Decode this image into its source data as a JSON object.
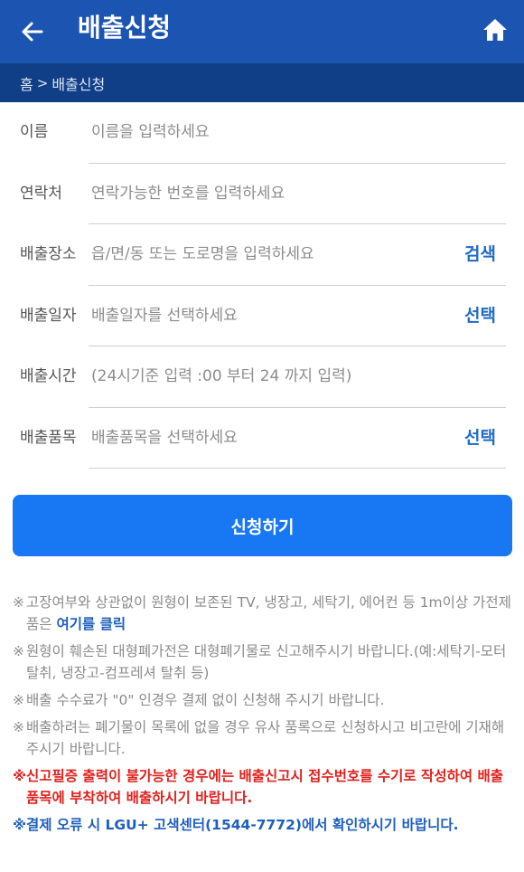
{
  "header": {
    "title": "배출신청"
  },
  "breadcrumb": {
    "home": "홈",
    "sep": ">",
    "current": "배출신청"
  },
  "form": {
    "rows": [
      {
        "label": "이름",
        "placeholder": "이름을 입력하세요",
        "action": ""
      },
      {
        "label": "연락처",
        "placeholder": "연락가능한 번호를 입력하세요",
        "action": ""
      },
      {
        "label": "배출장소",
        "placeholder": "읍/면/동 또는 도로명을 입력하세요",
        "action": "검색"
      },
      {
        "label": "배출일자",
        "placeholder": "배출일자를 선택하세요",
        "action": "선택"
      },
      {
        "label": "배출시간",
        "placeholder": "(24시기준 입력 :00 부터 24 까지 입력)",
        "action": ""
      },
      {
        "label": "배출품목",
        "placeholder": "배출품목을 선택하세요",
        "action": "선택"
      }
    ],
    "submit_label": "신청하기"
  },
  "notes": {
    "mark": "※",
    "note1": "고장여부와 상관없이 원형이 보존된 TV, 냉장고, 세탁기, 에어컨 등 1m이상 가전제품은 ",
    "note1_link": "여기를 클릭",
    "note2": "원형이 훼손된 대형폐가전은 대형폐기물로 신고해주시기 바랍니다.(예:세탁기-모터탈취, 냉장고-컴프레셔 탈취 등)",
    "note3": "배출 수수료가 \"0\" 인경우 결제 없이 신청해 주시기 바랍니다.",
    "note4": "배출하려는 폐기물이 목록에 없을 경우 유사 품록으로 신청하시고 비고란에 기재해주시기 바랍니다.",
    "note5": "신고필증 출력이 불가능한 경우에는 배출신고시 접수번호를 수기로 작성하여 배출 품목에 부착하여 배출하시기 바랍니다.",
    "note6": "결제 오류 시 LGU+ 고색센터(1544-7772)에서 확인하시기 바랍니다."
  }
}
